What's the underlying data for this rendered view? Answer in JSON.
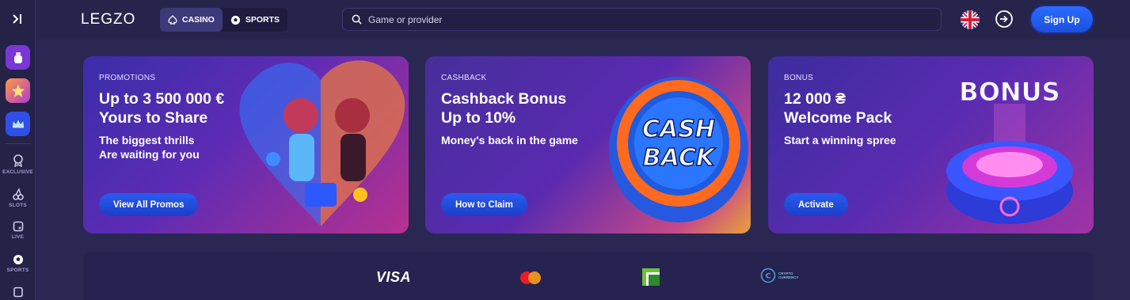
{
  "header": {
    "logo": "LEGZO",
    "tabs": [
      {
        "label": "CASINO",
        "active": true,
        "icon": "spade-icon"
      },
      {
        "label": "SPORTS",
        "active": false,
        "icon": "soccer-ball-icon"
      }
    ],
    "search_placeholder": "Game or provider",
    "language_icon": "uk-flag-icon",
    "signup_label": "Sign Up"
  },
  "sidebar": {
    "tiles": [
      {
        "name": "gift-bag-icon",
        "color": "#8a3ad8"
      },
      {
        "name": "star-icon",
        "color": "#ff7a3c"
      },
      {
        "name": "crown-icon",
        "color": "#3a5cff"
      }
    ],
    "items": [
      {
        "label": "EXCLUSIVE",
        "icon": "award-icon"
      },
      {
        "label": "SLOTS",
        "icon": "cherry-icon"
      },
      {
        "label": "LIVE",
        "icon": "live-icon"
      },
      {
        "label": "SPORTS",
        "icon": "soccer-ball-icon"
      }
    ]
  },
  "promos": [
    {
      "kicker": "PROMOTIONS",
      "title_lines": [
        "Up to 3 500 000 €",
        "Yours to Share"
      ],
      "desc_lines": [
        "The biggest thrills",
        "Are waiting for you"
      ],
      "cta": "View All Promos"
    },
    {
      "kicker": "CASHBACK",
      "title_lines": [
        "Cashback Bonus",
        "Up to 10%"
      ],
      "desc_lines": [
        "Money's back in the game"
      ],
      "cta": "How to Claim",
      "art_text": [
        "CASH",
        "BACK"
      ]
    },
    {
      "kicker": "BONUS",
      "title_lines": [
        "12 000 ₴",
        "Welcome Pack"
      ],
      "desc_lines": [
        "Start a winning spree"
      ],
      "cta": "Activate",
      "art_text": "BONUS"
    }
  ],
  "payments": {
    "visa": "VISA",
    "crypto": [
      "CRYPTO",
      "CURRENCY"
    ]
  },
  "colors": {
    "background": "#2a2752",
    "accent": "#2a5cf0"
  }
}
